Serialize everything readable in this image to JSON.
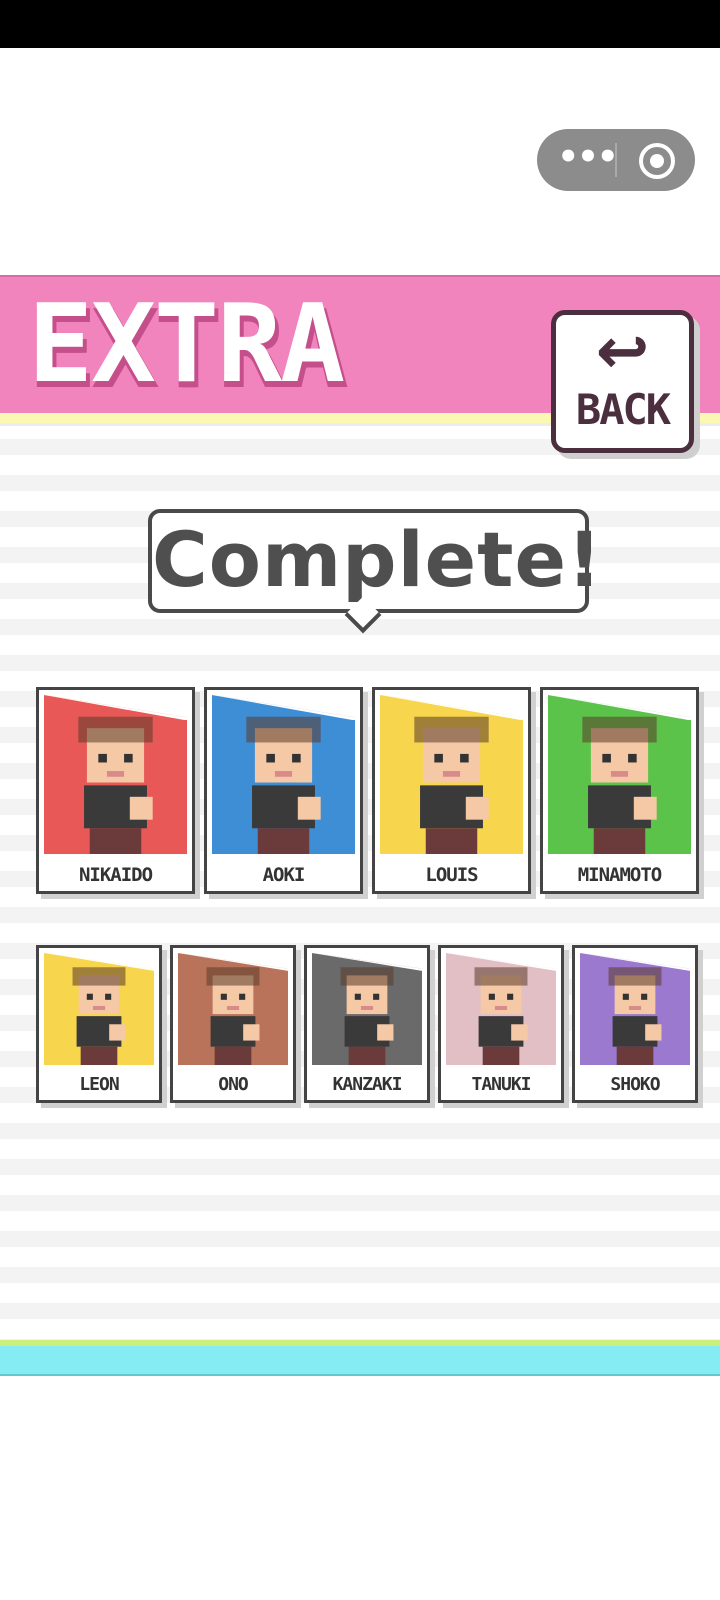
{
  "header": {
    "title": "EXTRA"
  },
  "back_button": {
    "label": "BACK",
    "arrow": "↩"
  },
  "status_bubble": {
    "text": "Complete!"
  },
  "capsule": {
    "more_label": "•••"
  },
  "characters_row1": [
    {
      "name": "NIKAIDO",
      "color": "#e85856"
    },
    {
      "name": "AOKI",
      "color": "#3e8ed6"
    },
    {
      "name": "LOUIS",
      "color": "#f7d54c"
    },
    {
      "name": "MINAMOTO",
      "color": "#5cc34a"
    }
  ],
  "characters_row2": [
    {
      "name": "LEON",
      "color": "#f7d54c"
    },
    {
      "name": "ONO",
      "color": "#b8735a"
    },
    {
      "name": "KANZAKI",
      "color": "#6a6a6a"
    },
    {
      "name": "TANUKI",
      "color": "#e2bfc4"
    },
    {
      "name": "SHOKO",
      "color": "#9b79cf"
    }
  ]
}
